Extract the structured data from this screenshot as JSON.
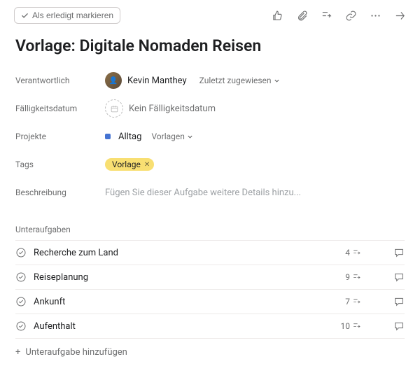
{
  "toolbar": {
    "complete_label": "Als erledigt markieren"
  },
  "title": "Vorlage: Digitale Nomaden Reisen",
  "fields": {
    "assignee_label": "Verantwortlich",
    "assignee_name": "Kevin Manthey",
    "assignee_link": "Zuletzt zugewiesen",
    "due_label": "Fälligkeitsdatum",
    "due_empty": "Kein Fälligkeitsdatum",
    "projects_label": "Projekte",
    "project_name": "Alltag",
    "project_column": "Vorlagen",
    "tags_label": "Tags",
    "tag": "Vorlage",
    "desc_label": "Beschreibung",
    "desc_placeholder": "Fügen Sie dieser Aufgabe weitere Details hinzu..."
  },
  "subtasks": {
    "heading": "Unteraufgaben",
    "items": [
      {
        "name": "Recherche zum Land",
        "count": "4"
      },
      {
        "name": "Reiseplanung",
        "count": "9"
      },
      {
        "name": "Ankunft",
        "count": "7"
      },
      {
        "name": "Aufenthalt",
        "count": "10"
      }
    ],
    "add_label": "Unteraufgabe hinzufügen"
  }
}
